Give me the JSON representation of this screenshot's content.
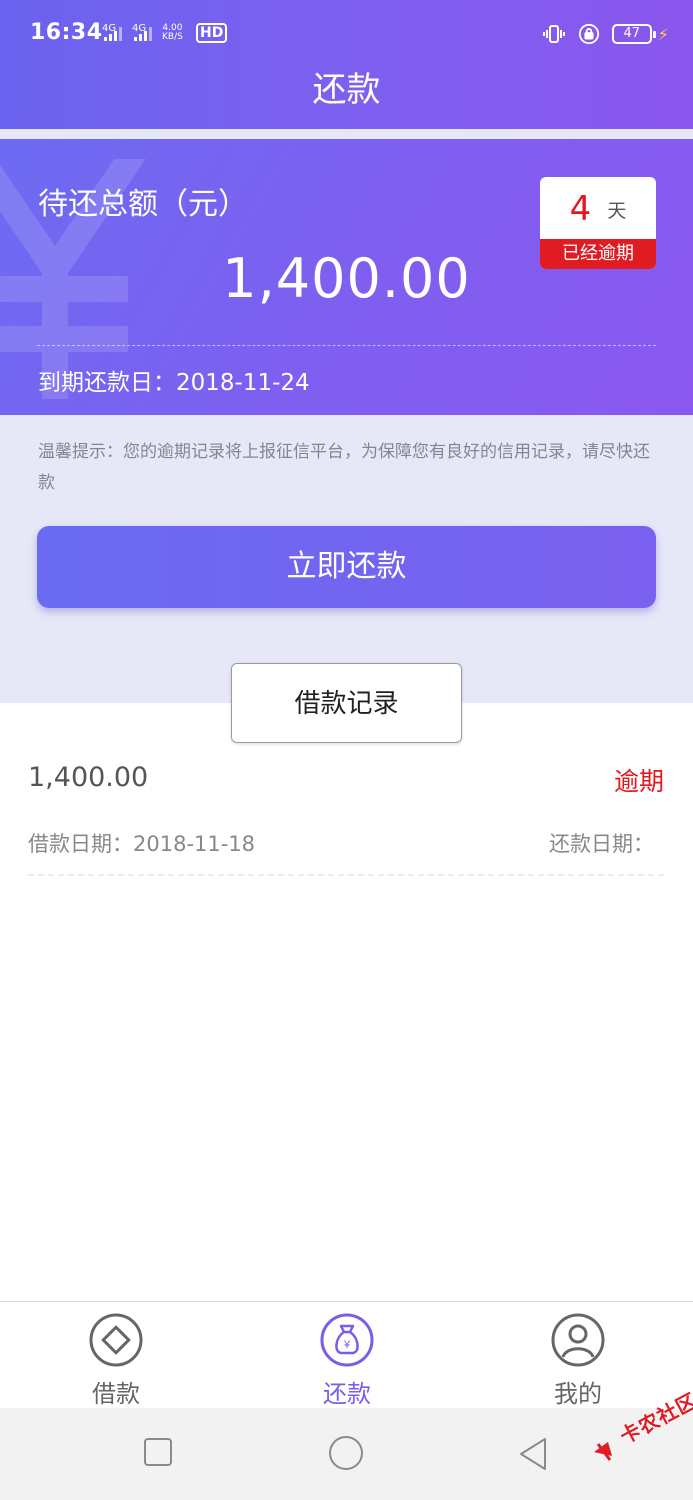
{
  "status_bar": {
    "time": "16:34",
    "signal1_label": "4G",
    "signal2_label": "4G",
    "speed_value": "4.00",
    "speed_unit": "KB/S",
    "hd_label": "HD",
    "battery_level": "47"
  },
  "header": {
    "title": "还款"
  },
  "summary": {
    "pending_label": "待还总额（元）",
    "pending_amount": "1,400.00",
    "overdue_days": "4",
    "overdue_days_unit": "天",
    "overdue_status": "已经逾期",
    "due_date": "到期还款日：2018-11-24"
  },
  "notice": {
    "text": "温馨提示：您的逾期记录将上报征信平台，为保障您有良好的信用记录，请尽快还款"
  },
  "actions": {
    "repay_now_label": "立即还款"
  },
  "records": {
    "tab_label": "借款记录",
    "items": [
      {
        "amount": "1,400.00",
        "status": "逾期",
        "loan_date": "借款日期：2018-11-18",
        "repay_date": "还款日期："
      }
    ]
  },
  "tab_bar": {
    "items": [
      {
        "label": "借款",
        "icon": "diamond-icon",
        "active": false
      },
      {
        "label": "还款",
        "icon": "money-bag-icon",
        "active": true
      },
      {
        "label": "我的",
        "icon": "user-icon",
        "active": false
      }
    ]
  },
  "colors": {
    "brand": "#7a60ee",
    "overdue": "#e5161d",
    "notice_bg": "#e6e8f8"
  },
  "watermark": {
    "text": "卡农社区"
  }
}
